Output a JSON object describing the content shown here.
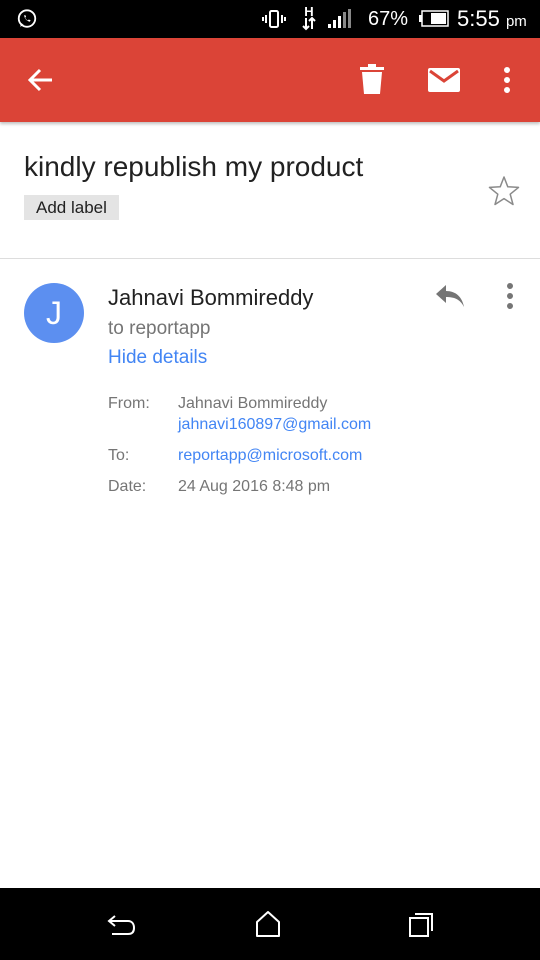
{
  "status_bar": {
    "battery_percent": "67%",
    "time": "5:55",
    "ampm": "pm",
    "network_type": "H",
    "icons": [
      "whatsapp-icon",
      "vibrate-icon",
      "hplus-data-icon",
      "signal-icon",
      "battery-icon"
    ]
  },
  "app_bar": {
    "color": "#db4437",
    "icons": [
      "back-arrow-icon",
      "trash-icon",
      "mail-icon",
      "more-vert-icon"
    ]
  },
  "email": {
    "subject": "kindly republish my product",
    "add_label": "Add label",
    "sender_name": "Jahnavi Bommireddy",
    "avatar_initial": "J",
    "avatar_color": "#5c8ff0",
    "recipient_line": "to reportapp",
    "hide_details": "Hide details",
    "details": {
      "from_label": "From:",
      "from_name": "Jahnavi Bommireddy",
      "from_email": "jahnavi160897@gmail.com",
      "to_label": "To:",
      "to_email": "reportapp@microsoft.com",
      "date_label": "Date:",
      "date_value": "24 Aug 2016 8:48 pm"
    }
  },
  "nav_bar": {
    "icons": [
      "nav-back-icon",
      "nav-home-icon",
      "nav-recent-icon"
    ]
  }
}
